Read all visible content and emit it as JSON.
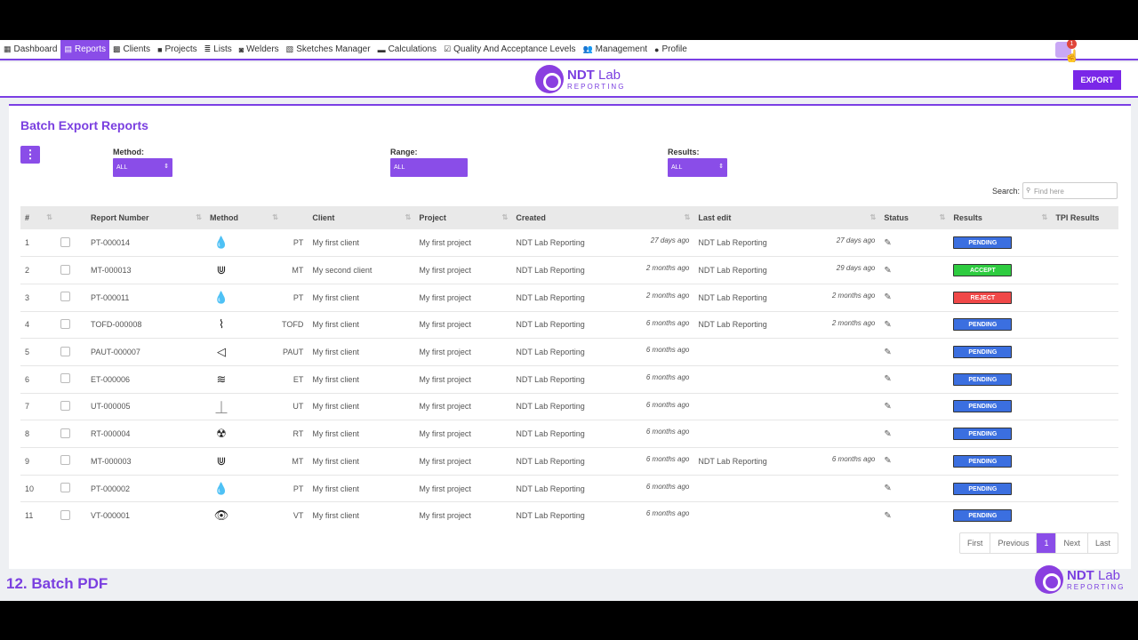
{
  "nav": {
    "items": [
      {
        "label": "Dashboard",
        "icon": "dashboard-icon",
        "glyph": "▦"
      },
      {
        "label": "Reports",
        "icon": "reports-icon",
        "glyph": "▤",
        "active": true
      },
      {
        "label": "Clients",
        "icon": "clients-icon",
        "glyph": "▩"
      },
      {
        "label": "Projects",
        "icon": "projects-icon",
        "glyph": "■"
      },
      {
        "label": "Lists",
        "icon": "lists-icon",
        "glyph": "≣"
      },
      {
        "label": "Welders",
        "icon": "welders-icon",
        "glyph": "◙"
      },
      {
        "label": "Sketches Manager",
        "icon": "sketches-icon",
        "glyph": "▧"
      },
      {
        "label": "Calculations",
        "icon": "calculations-icon",
        "glyph": "▬"
      },
      {
        "label": "Quality And Acceptance Levels",
        "icon": "quality-icon",
        "glyph": "☑"
      },
      {
        "label": "Management",
        "icon": "management-icon",
        "glyph": "👥"
      },
      {
        "label": "Profile",
        "icon": "profile-icon",
        "glyph": "●"
      }
    ],
    "notification_count": "1"
  },
  "header": {
    "logo_main_bold": "NDT",
    "logo_main_rest": " Lab",
    "logo_sub": "REPORTING",
    "export_label": "EXPORT"
  },
  "page": {
    "title": "Batch Export Reports",
    "menu_glyph": "⋮",
    "filters": {
      "method_label": "Method:",
      "method_value": "ALL",
      "range_label": "Range:",
      "range_value": "ALL",
      "results_label": "Results:",
      "results_value": "ALL"
    },
    "search_label": "Search:",
    "search_placeholder": "Find here"
  },
  "table": {
    "columns": [
      "#",
      "",
      "Report Number",
      "Method",
      "",
      "Client",
      "Project",
      "Created",
      "",
      "Last edit",
      "",
      "Status",
      "Results",
      "TPI Results"
    ],
    "rows": [
      {
        "n": "1",
        "report": "PT-000014",
        "icon": "droplet-icon",
        "glyph": "💧",
        "method": "PT",
        "client": "My first client",
        "project": "My first project",
        "created_by": "NDT Lab Reporting",
        "created": "27 days ago",
        "edit_by": "NDT Lab Reporting",
        "edited": "27 days ago",
        "result": "PENDING"
      },
      {
        "n": "2",
        "report": "MT-000013",
        "icon": "magnet-icon",
        "glyph": "⋓",
        "method": "MT",
        "client": "My second client",
        "project": "My first project",
        "created_by": "NDT Lab Reporting",
        "created": "2 months ago",
        "edit_by": "NDT Lab Reporting",
        "edited": "29 days ago",
        "result": "ACCEPT"
      },
      {
        "n": "3",
        "report": "PT-000011",
        "icon": "droplet-icon",
        "glyph": "💧",
        "method": "PT",
        "client": "My first client",
        "project": "My first project",
        "created_by": "NDT Lab Reporting",
        "created": "2 months ago",
        "edit_by": "NDT Lab Reporting",
        "edited": "2 months ago",
        "result": "REJECT"
      },
      {
        "n": "4",
        "report": "TOFD-000008",
        "icon": "tofd-icon",
        "glyph": "⌇",
        "method": "TOFD",
        "client": "My first client",
        "project": "My first project",
        "created_by": "NDT Lab Reporting",
        "created": "6 months ago",
        "edit_by": "NDT Lab Reporting",
        "edited": "2 months ago",
        "result": "PENDING"
      },
      {
        "n": "5",
        "report": "PAUT-000007",
        "icon": "paut-icon",
        "glyph": "◁",
        "method": "PAUT",
        "client": "My first client",
        "project": "My first project",
        "created_by": "NDT Lab Reporting",
        "created": "6 months ago",
        "edit_by": "",
        "edited": "",
        "result": "PENDING"
      },
      {
        "n": "6",
        "report": "ET-000006",
        "icon": "coil-icon",
        "glyph": "≋",
        "method": "ET",
        "client": "My first client",
        "project": "My first project",
        "created_by": "NDT Lab Reporting",
        "created": "6 months ago",
        "edit_by": "",
        "edited": "",
        "result": "PENDING"
      },
      {
        "n": "7",
        "report": "UT-000005",
        "icon": "ultrasonic-icon",
        "glyph": "⏊",
        "method": "UT",
        "client": "My first client",
        "project": "My first project",
        "created_by": "NDT Lab Reporting",
        "created": "6 months ago",
        "edit_by": "",
        "edited": "",
        "result": "PENDING"
      },
      {
        "n": "8",
        "report": "RT-000004",
        "icon": "radiation-icon",
        "glyph": "☢",
        "method": "RT",
        "client": "My first client",
        "project": "My first project",
        "created_by": "NDT Lab Reporting",
        "created": "6 months ago",
        "edit_by": "",
        "edited": "",
        "result": "PENDING"
      },
      {
        "n": "9",
        "report": "MT-000003",
        "icon": "magnet-icon",
        "glyph": "⋓",
        "method": "MT",
        "client": "My first client",
        "project": "My first project",
        "created_by": "NDT Lab Reporting",
        "created": "6 months ago",
        "edit_by": "NDT Lab Reporting",
        "edited": "6 months ago",
        "result": "PENDING"
      },
      {
        "n": "10",
        "report": "PT-000002",
        "icon": "droplet-icon",
        "glyph": "💧",
        "method": "PT",
        "client": "My first client",
        "project": "My first project",
        "created_by": "NDT Lab Reporting",
        "created": "6 months ago",
        "edit_by": "",
        "edited": "",
        "result": "PENDING"
      },
      {
        "n": "11",
        "report": "VT-000001",
        "icon": "eye-icon",
        "glyph": "👁",
        "method": "VT",
        "client": "My first client",
        "project": "My first project",
        "created_by": "NDT Lab Reporting",
        "created": "6 months ago",
        "edit_by": "",
        "edited": "",
        "result": "PENDING"
      }
    ],
    "status_glyph": "✎"
  },
  "result_colors": {
    "PENDING": "#3b6fe0",
    "ACCEPT": "#2ecc40",
    "REJECT": "#f04848"
  },
  "pagination": {
    "first": "First",
    "previous": "Previous",
    "current": "1",
    "next": "Next",
    "last": "Last"
  },
  "footer": {
    "caption": "12. Batch PDF"
  }
}
